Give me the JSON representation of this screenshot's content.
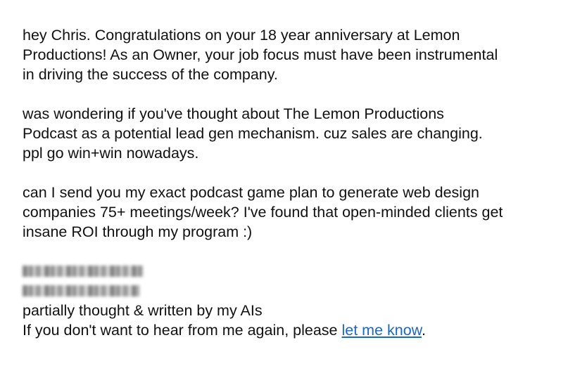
{
  "email": {
    "paragraphs": [
      "hey Chris. Congratulations on your 18 year anniversary at Lemon\nProductions! As an Owner, your job focus must have been instrumental\nin driving the success of the company.",
      "was wondering if you've thought about The Lemon Productions\nPodcast as a potential lead gen mechanism. cuz sales are changing.\nppl go win+win nowadays.",
      "can I send you my exact podcast game plan to generate web design\ncompanies 75+ meetings/week? I've found that open-minded clients get\ninsane ROI through my program :)"
    ],
    "signature": {
      "credit_line": "partially thought & written by my AIs",
      "unsubscribe_prefix": "If you don't want to hear from me again, please ",
      "unsubscribe_link": "let me know",
      "unsubscribe_suffix": "."
    }
  },
  "colors": {
    "text": "#111111",
    "link": "#1a66c9",
    "background": "#ffffff"
  }
}
